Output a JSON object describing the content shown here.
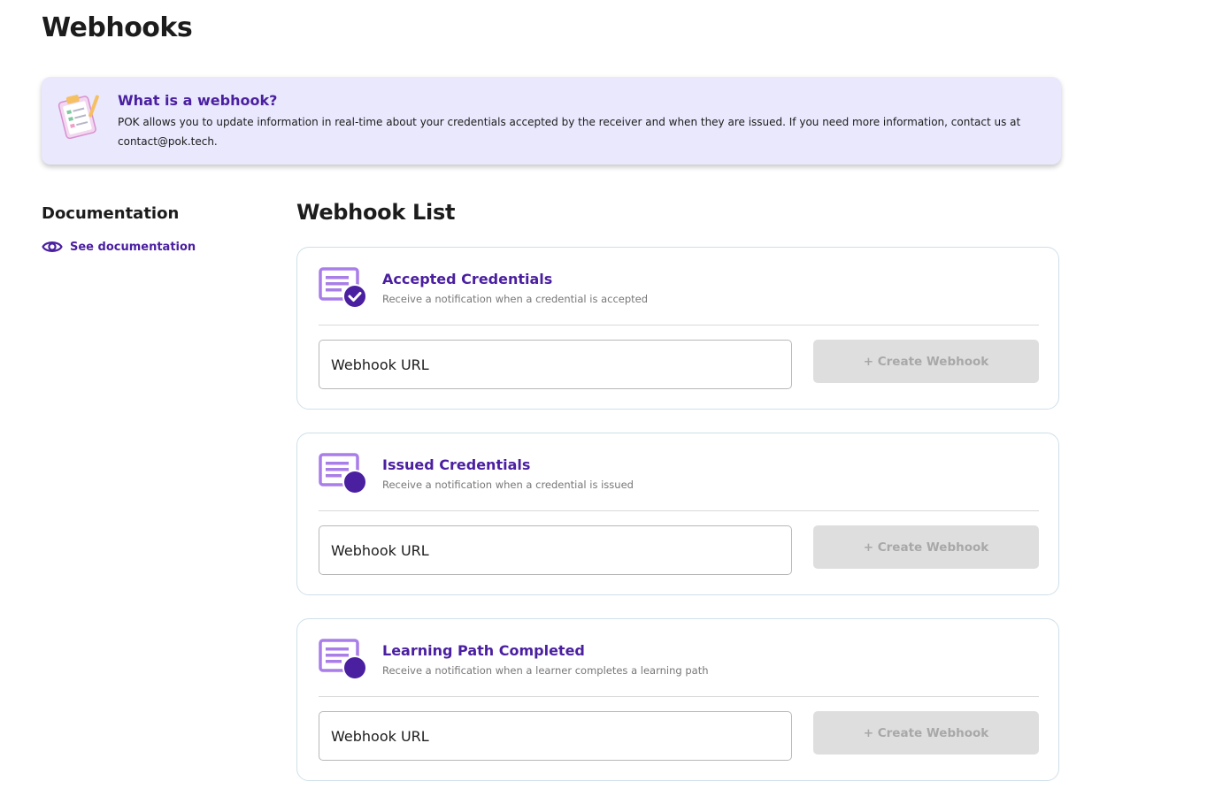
{
  "page": {
    "title": "Webhooks"
  },
  "info": {
    "title": "What is a webhook?",
    "text": "POK allows you to update information in real-time about your credentials accepted by the receiver and when they are issued. If you need more information, contact us at contact@pok.tech.",
    "icon": "clipboard-icon"
  },
  "documentation": {
    "heading": "Documentation",
    "link_label": "See documentation",
    "link_icon": "eye-icon"
  },
  "webhook_list": {
    "heading": "Webhook List",
    "cards": [
      {
        "title": "Accepted Credentials",
        "description": "Receive a notification when a credential is accepted",
        "icon": "credential-check-icon",
        "input_placeholder": "Webhook URL",
        "input_value": "",
        "button_label": "+ Create Webhook"
      },
      {
        "title": "Issued Credentials",
        "description": "Receive a notification when a credential is issued",
        "icon": "credential-issued-icon",
        "input_placeholder": "Webhook URL",
        "input_value": "",
        "button_label": "+ Create Webhook"
      },
      {
        "title": "Learning Path Completed",
        "description": "Receive a notification when a learner completes a learning path",
        "icon": "learning-path-icon",
        "input_placeholder": "Webhook URL",
        "input_value": "",
        "button_label": "+ Create Webhook"
      }
    ]
  },
  "colors": {
    "accent": "#4a1fa0",
    "icon_light": "#a97ee8",
    "banner_bg": "#e9e8fd",
    "button_disabled_bg": "#dedede",
    "button_disabled_text": "#a8a8a8",
    "card_border": "#cfe0ea"
  }
}
